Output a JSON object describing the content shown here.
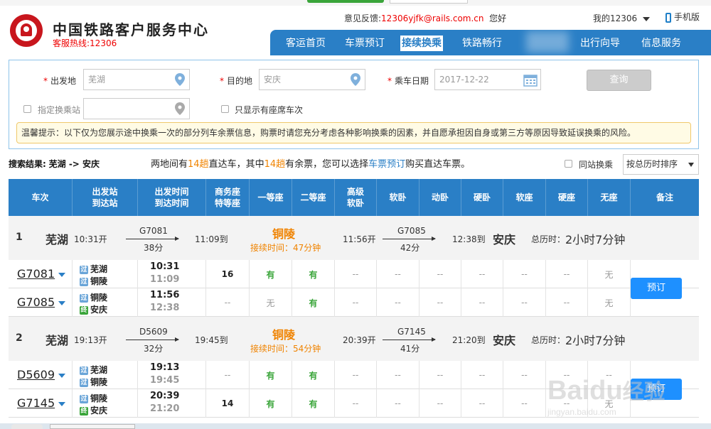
{
  "header": {
    "title": "中国铁路客户服务中心",
    "hotline": "客服热线:12306",
    "feedback_label": "意见反馈:",
    "feedback_email": "12306yjfk@rails.com.cn",
    "feedback_suffix": "您好",
    "my12306": "我的12306",
    "mobile": "手机版",
    "nav": [
      "客运首页",
      "车票预订",
      "接续换乘",
      "铁路畅行",
      "出行向导",
      "信息服务"
    ],
    "nav_active": "接续换乘"
  },
  "form": {
    "from_label": "出发地",
    "from_value": "芜湖",
    "to_label": "目的地",
    "to_value": "安庆",
    "date_label": "乘车日期",
    "date_value": "2017-12-22",
    "query_btn": "查询",
    "transfer_label": "指定换乘站",
    "seat_only_label": "只显示有座席车次",
    "tip": "温馨提示：以下仅为您展示途中换乘一次的部分列车余票信息，购票时请您充分考虑各种影响换乘的因素，并自愿承担因自身或第三方等原因导致延误换乘的风险。"
  },
  "result": {
    "label": "搜索结果:",
    "route": "芜湖 -> 安庆",
    "summary_a": "两地间有",
    "direct_count": "14趟",
    "summary_b": "直达车，其中",
    "avail_count": "14趟",
    "summary_c": "有余票，您可以选择",
    "booking_link": "车票预订",
    "summary_d": "购买直达车票。",
    "same_station": "同站换乘",
    "sort": "按总历时排序"
  },
  "columns": [
    "车次",
    "出发站\n到达站",
    "出发时间\n到达时间",
    "商务座\n特等座",
    "一等座",
    "二等座",
    "高级\n软卧",
    "软卧",
    "动卧",
    "硬卧",
    "软座",
    "硬座",
    "无座",
    "备注"
  ],
  "plans": [
    {
      "index": "1",
      "from": "芜湖",
      "dep": "10:31开",
      "train1": "G7081",
      "dur1": "38分",
      "arr1": "11:09到",
      "transfer": "铜陵",
      "wait": "接续时间：47分钟",
      "dep2": "11:56开",
      "train2": "G7085",
      "dur2": "42分",
      "arr2": "12:38到",
      "to": "安庆",
      "total_label": "总历时：",
      "total": "2小时7分钟",
      "book": "预订",
      "legs": [
        {
          "train": "G7081",
          "from": "芜湖",
          "to": "铜陵",
          "from_tag": "过",
          "to_tag": "过",
          "dep": "10:31",
          "arr": "11:09",
          "seats": [
            "16",
            "有",
            "有",
            "--",
            "--",
            "--",
            "--",
            "--",
            "--",
            "无"
          ]
        },
        {
          "train": "G7085",
          "from": "铜陵",
          "to": "安庆",
          "from_tag": "过",
          "to_tag": "终",
          "dep": "11:56",
          "arr": "12:38",
          "seats": [
            "--",
            "无",
            "有",
            "--",
            "--",
            "--",
            "--",
            "--",
            "--",
            "无"
          ]
        }
      ]
    },
    {
      "index": "2",
      "from": "芜湖",
      "dep": "19:13开",
      "train1": "D5609",
      "dur1": "32分",
      "arr1": "19:45到",
      "transfer": "铜陵",
      "wait": "接续时间：54分钟",
      "dep2": "20:39开",
      "train2": "G7145",
      "dur2": "41分",
      "arr2": "21:20到",
      "to": "安庆",
      "total_label": "总历时：",
      "total": "2小时7分钟",
      "book": "预订",
      "legs": [
        {
          "train": "D5609",
          "from": "芜湖",
          "to": "铜陵",
          "from_tag": "过",
          "to_tag": "过",
          "dep": "19:13",
          "arr": "19:45",
          "seats": [
            "--",
            "有",
            "有",
            "--",
            "--",
            "--",
            "--",
            "--",
            "--",
            "--"
          ]
        },
        {
          "train": "G7145",
          "from": "铜陵",
          "to": "安庆",
          "from_tag": "过",
          "to_tag": "终",
          "dep": "20:39",
          "arr": "21:20",
          "seats": [
            "14",
            "有",
            "有",
            "--",
            "--",
            "--",
            "--",
            "--",
            "--",
            "无"
          ]
        }
      ]
    }
  ],
  "watermark": "Baidu经验",
  "watermark_sub": "jingyan.baidu.com"
}
